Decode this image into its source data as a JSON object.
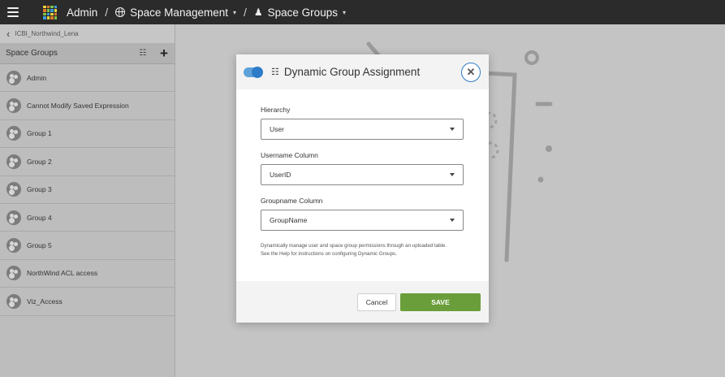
{
  "topbar": {
    "admin_label": "Admin",
    "separator": "/",
    "space_management_label": "Space Management",
    "space_groups_label": "Space Groups",
    "caret": "▾",
    "logo_colors": [
      "#e8d23a",
      "#e07b2a",
      "#7fc34a",
      "#3a9ad9"
    ]
  },
  "sidebar": {
    "back_label": "ICBI_Northwind_Lena",
    "section_title": "Space Groups",
    "items": [
      {
        "label": "Admin"
      },
      {
        "label": "Cannot Modify Saved Expression"
      },
      {
        "label": "Group 1"
      },
      {
        "label": "Group 2"
      },
      {
        "label": "Group 3"
      },
      {
        "label": "Group 4"
      },
      {
        "label": "Group 5"
      },
      {
        "label": "NorthWind ACL access"
      },
      {
        "label": "Viz_Access"
      }
    ]
  },
  "modal": {
    "title": "Dynamic Group Assignment",
    "toggle_on": true,
    "fields": [
      {
        "label": "Hierarchy",
        "value": "User"
      },
      {
        "label": "Username Column",
        "value": "UserID"
      },
      {
        "label": "Groupname Column",
        "value": "GroupName"
      }
    ],
    "help_line1": "Dynamically manage user and space group permissions through an uploaded table.",
    "help_line2": "See the Help for instructions on configuring Dynamic Groups.",
    "cancel_label": "Cancel",
    "save_label": "SAVE"
  },
  "colors": {
    "accent_blue": "#2d7cc7",
    "save_green": "#6a9e3a",
    "topbar_bg": "#2b2b2b"
  }
}
